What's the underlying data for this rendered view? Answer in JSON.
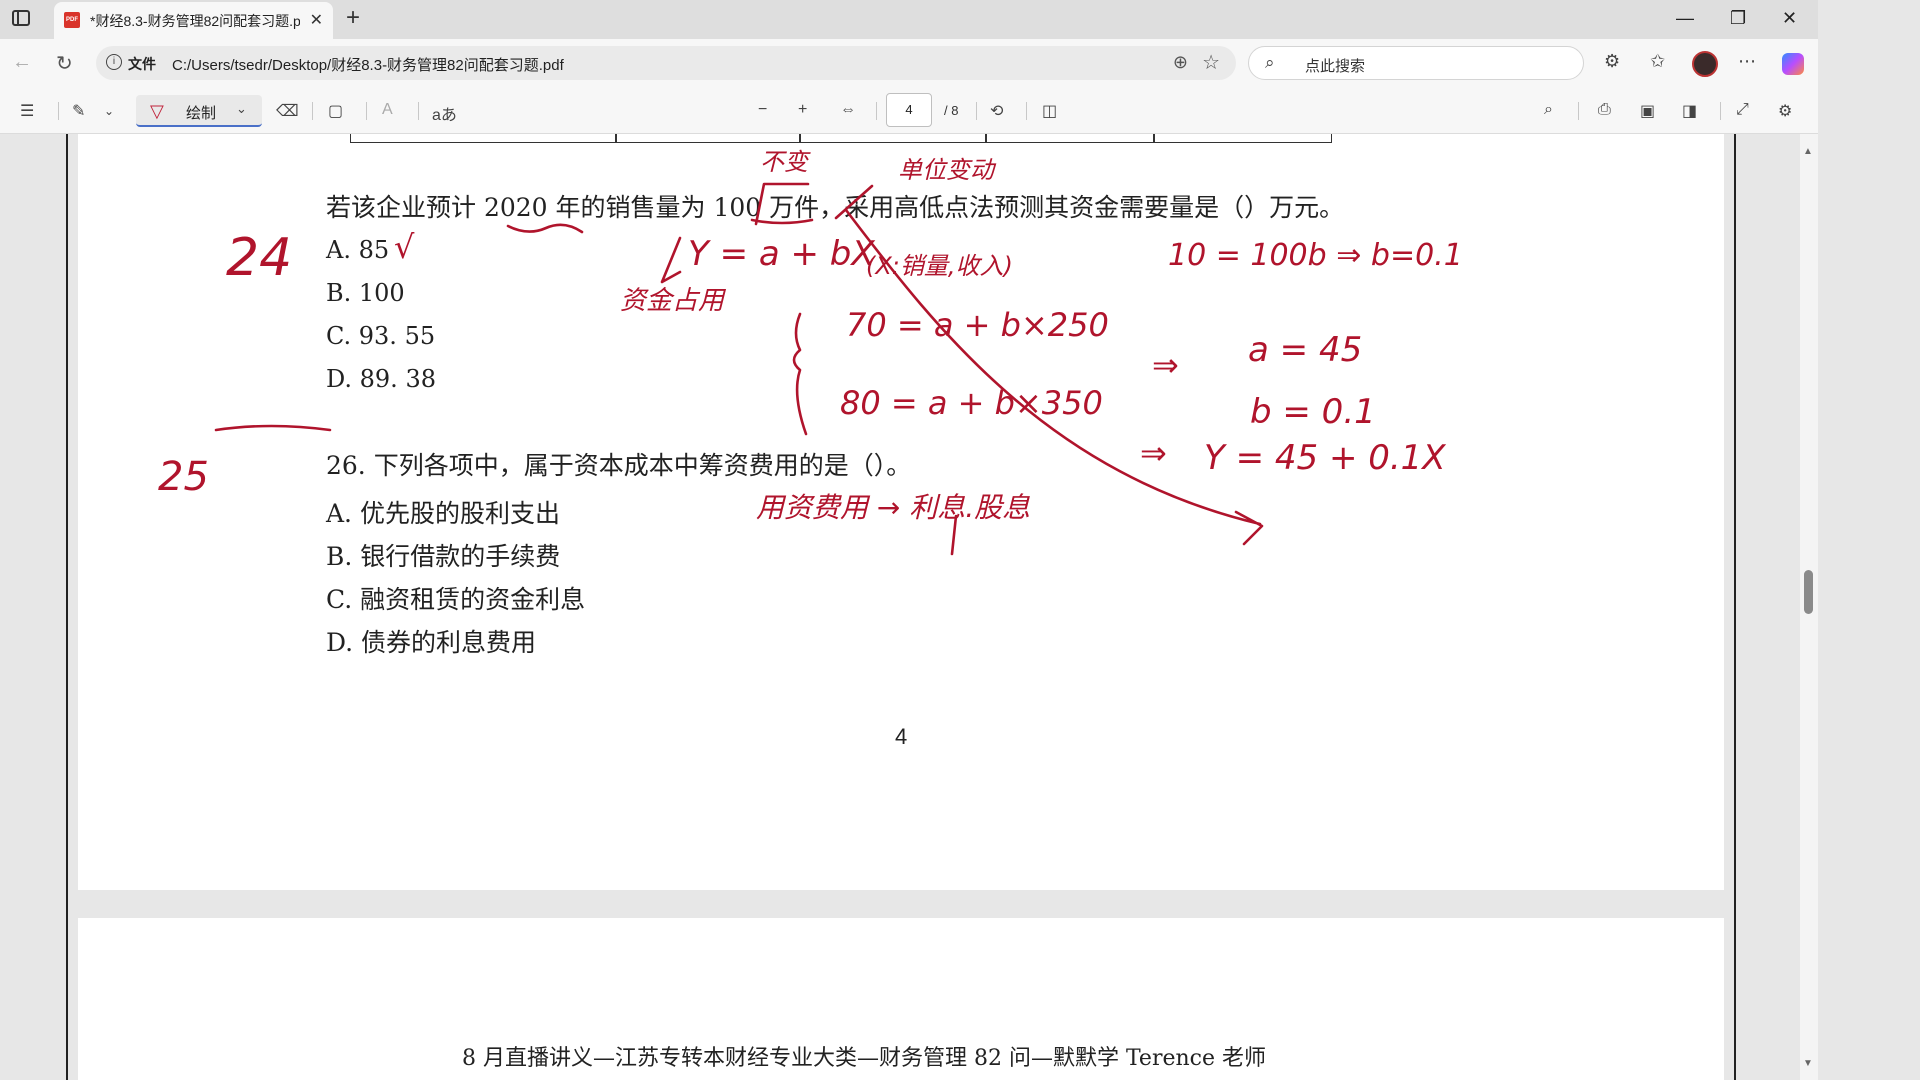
{
  "browser": {
    "tab_title": "*财经8.3-财务管理82问配套习题.pdf",
    "address_scheme": "文件",
    "address_path": "C:/Users/tsedr/Desktop/财经8.3-财务管理82问配套习题.pdf",
    "search_placeholder": "点此搜索"
  },
  "pdf_toolbar": {
    "draw_label": "绘制",
    "read_aloud": "aあ",
    "current_page": "4",
    "total_pages": "/ 8"
  },
  "document": {
    "q25_stem": "若该企业预计 2020 年的销售量为 100 万件，采用高低点法预测其资金需要量是（）万元。",
    "q25_options": [
      "A. 85",
      "B. 100",
      "C. 93. 55",
      "D. 89. 38"
    ],
    "q26_stem": "26. 下列各项中，属于资本成本中筹资费用的是（）。",
    "q26_options": [
      "A. 优先股的股利支出",
      "B. 银行借款的手续费",
      "C. 融资租赁的资金利息",
      "D. 债券的利息费用"
    ],
    "page_number": "4",
    "next_page_header": "8 月直播讲义—江苏专转本财经专业大类—财务管理 82 问—默默学 Terence 老师"
  },
  "annotations": {
    "num_24": "24",
    "num_25": "25",
    "check": "√",
    "label_bubian": "不变",
    "label_danwei": "单位变动",
    "formula_main": "Y = a + bX",
    "formula_note": "(X:销量,收入)",
    "label_zijin": "资金占用",
    "eq_b": "10 = 100b ⇒ b=0.1",
    "eq1": "70 = a + b×250",
    "eq2": "80 = a + b×350",
    "arrow1": "⇒",
    "res_a": "a = 45",
    "res_b": "b = 0.1",
    "arrow2": "⇒",
    "res_y": "Y = 45 + 0.1X",
    "label_yongzi": "用资费用 → 利息.股息"
  },
  "colors": {
    "ink": "#b0142c",
    "accent": "#4a70c8"
  }
}
